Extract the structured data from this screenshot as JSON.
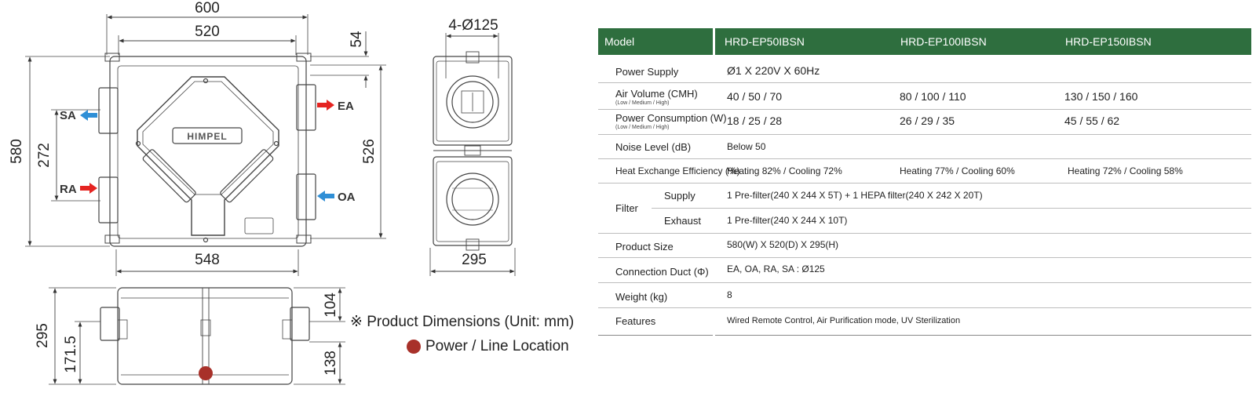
{
  "drawing": {
    "top_view": {
      "dim_overall_width": "600",
      "dim_inner_width": "520",
      "dim_flange": "54",
      "dim_overall_height": "580",
      "dim_port_spacing": "272",
      "dim_port_height": "526",
      "dim_bottom_width": "548",
      "logo_text": "HIMPEL",
      "ports": {
        "sa": "SA",
        "ra": "RA",
        "ea": "EA",
        "oa": "OA"
      }
    },
    "side_view": {
      "dim_ducts": "4-Ø125",
      "dim_depth": "295"
    },
    "front_view": {
      "dim_height": "295",
      "dim_power": "171.5",
      "dim_top": "104",
      "dim_bottom": "138"
    },
    "colors": {
      "supply_arrow": "#2f8fd6",
      "exhaust_arrow": "#e52421",
      "power_dot": "#a8312a"
    }
  },
  "notes": {
    "dimensions_note": "※ Product Dimensions (Unit: mm)",
    "power_note": "Power / Line Location"
  },
  "spec": {
    "header_color": "#2e6e3e",
    "header": {
      "label": "Model",
      "models": [
        "HRD-EP50IBSN",
        "HRD-EP100IBSN",
        "HRD-EP150IBSN"
      ]
    },
    "power_supply": {
      "label": "Power Supply",
      "value": "Ø1 X 220V X 60Hz"
    },
    "air_volume": {
      "label": "Air Volume (CMH)",
      "sublabel": "(Low / Medium / High)",
      "values": [
        "40 / 50 / 70",
        "80 / 100 / 110",
        "130 / 150 / 160"
      ]
    },
    "power_consumption": {
      "label": "Power Consumption (W)",
      "sublabel": "(Low / Medium / High)",
      "values": [
        "18 / 25 / 28",
        "26 / 29 / 35",
        "45 / 55 / 62"
      ]
    },
    "noise": {
      "label": "Noise Level (dB)",
      "value": "Below 50"
    },
    "heat_exchange": {
      "label": "Heat Exchange Efficiency (%)",
      "values": [
        "Heating 82% / Cooling 72%",
        "Heating 77% / Cooling 60%",
        "Heating 72% / Cooling 58%"
      ]
    },
    "filter": {
      "label": "Filter",
      "supply_label": "Supply",
      "supply_value": "1 Pre-filter(240 X 244 X 5T) + 1 HEPA filter(240 X 242 X 20T)",
      "exhaust_label": "Exhaust",
      "exhaust_value": "1 Pre-filter(240 X 244 X 10T)"
    },
    "product_size": {
      "label": "Product Size",
      "value": "580(W) X 520(D) X 295(H)"
    },
    "connection_duct": {
      "label": "Connection Duct (Φ)",
      "value": "EA, OA, RA, SA : Ø125"
    },
    "weight": {
      "label": "Weight (kg)",
      "value": "8"
    },
    "features": {
      "label": "Features",
      "value": "Wired Remote Control, Air Purification mode, UV Sterilization"
    }
  }
}
